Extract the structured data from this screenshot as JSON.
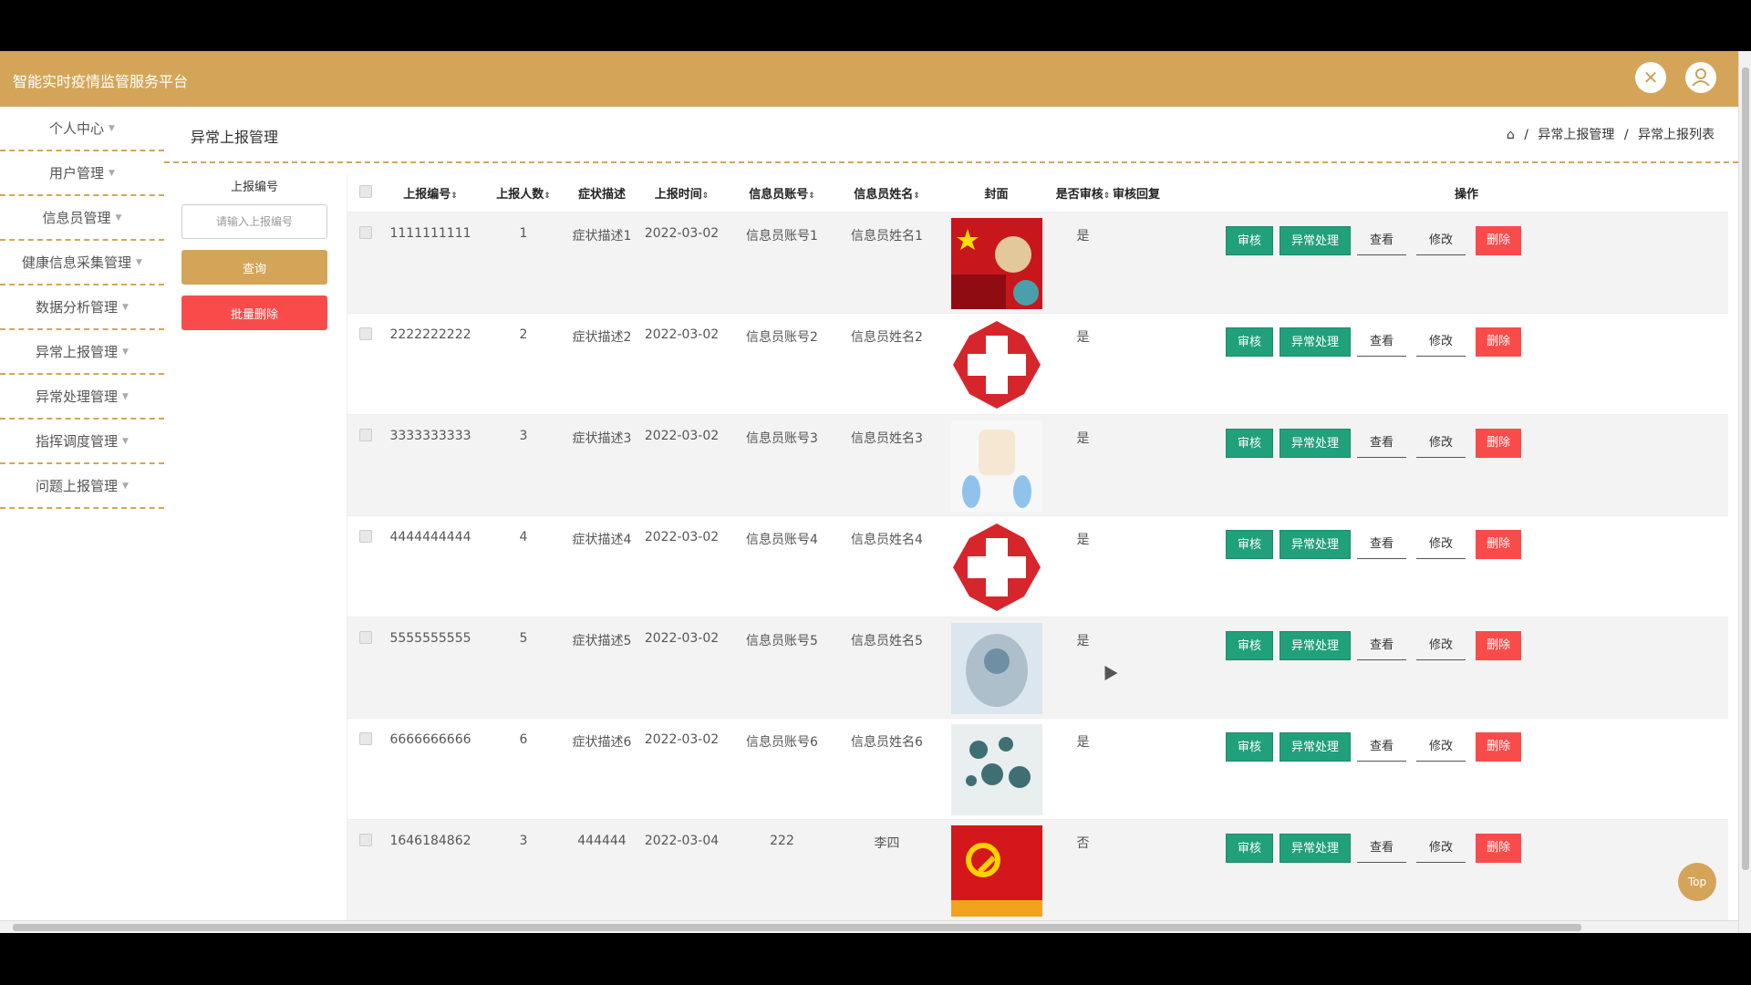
{
  "app_title": "智能实时疫情监管服务平台",
  "sidebar": {
    "items": [
      {
        "label": "个人中心"
      },
      {
        "label": "用户管理"
      },
      {
        "label": "信息员管理"
      },
      {
        "label": "健康信息采集管理"
      },
      {
        "label": "数据分析管理"
      },
      {
        "label": "异常上报管理"
      },
      {
        "label": "异常处理管理"
      },
      {
        "label": "指挥调度管理"
      },
      {
        "label": "问题上报管理"
      }
    ]
  },
  "page_title": "异常上报管理",
  "breadcrumb": {
    "sep": "/",
    "items": [
      "异常上报管理",
      "异常上报列表"
    ]
  },
  "search": {
    "label": "上报编号",
    "placeholder": "请输入上报编号",
    "query_label": "查询",
    "batch_delete_label": "批量删除"
  },
  "table": {
    "headers": {
      "report_no": "上报编号",
      "count": "上报人数",
      "symptom": "症状描述",
      "time": "上报时间",
      "account": "信息员账号",
      "name": "信息员姓名",
      "cover": "封面",
      "audited": "是否审核",
      "reply": "审核回复",
      "ops": "操作"
    },
    "sort_symbol": "⇕",
    "actions": {
      "audit": "审核",
      "handle": "异常处理",
      "view": "查看",
      "edit": "修改",
      "delete": "删除"
    },
    "rows": [
      {
        "report_no": "1111111111",
        "count": "1",
        "symptom": "症状描述1",
        "time": "2022-03-02",
        "account": "信息员账号1",
        "name": "信息员姓名1",
        "cover": "flag-fist-virus",
        "audited": "是",
        "reply": ""
      },
      {
        "report_no": "2222222222",
        "count": "2",
        "symptom": "症状描述2",
        "time": "2022-03-02",
        "account": "信息员账号2",
        "name": "信息员姓名2",
        "cover": "red-cross",
        "audited": "是",
        "reply": ""
      },
      {
        "report_no": "3333333333",
        "count": "3",
        "symptom": "症状描述3",
        "time": "2022-03-02",
        "account": "信息员账号3",
        "name": "信息员姓名3",
        "cover": "gloved-hands",
        "audited": "是",
        "reply": ""
      },
      {
        "report_no": "4444444444",
        "count": "4",
        "symptom": "症状描述4",
        "time": "2022-03-02",
        "account": "信息员账号4",
        "name": "信息员姓名4",
        "cover": "red-cross",
        "audited": "是",
        "reply": ""
      },
      {
        "report_no": "5555555555",
        "count": "5",
        "symptom": "症状描述5",
        "time": "2022-03-02",
        "account": "信息员账号5",
        "name": "信息员姓名5",
        "cover": "medical-worker",
        "audited": "是",
        "reply": ""
      },
      {
        "report_no": "6666666666",
        "count": "6",
        "symptom": "症状描述6",
        "time": "2022-03-02",
        "account": "信息员账号6",
        "name": "信息员姓名6",
        "cover": "medical-icons",
        "audited": "是",
        "reply": ""
      },
      {
        "report_no": "1646184862",
        "count": "3",
        "symptom": "444444",
        "time": "2022-03-04",
        "account": "222",
        "name": "李四",
        "cover": "party-flag",
        "audited": "否",
        "reply": ""
      }
    ]
  },
  "top_label": "Top",
  "colors": {
    "header": "#d4a559",
    "green": "#21a07c",
    "red": "#fa4b4b"
  }
}
